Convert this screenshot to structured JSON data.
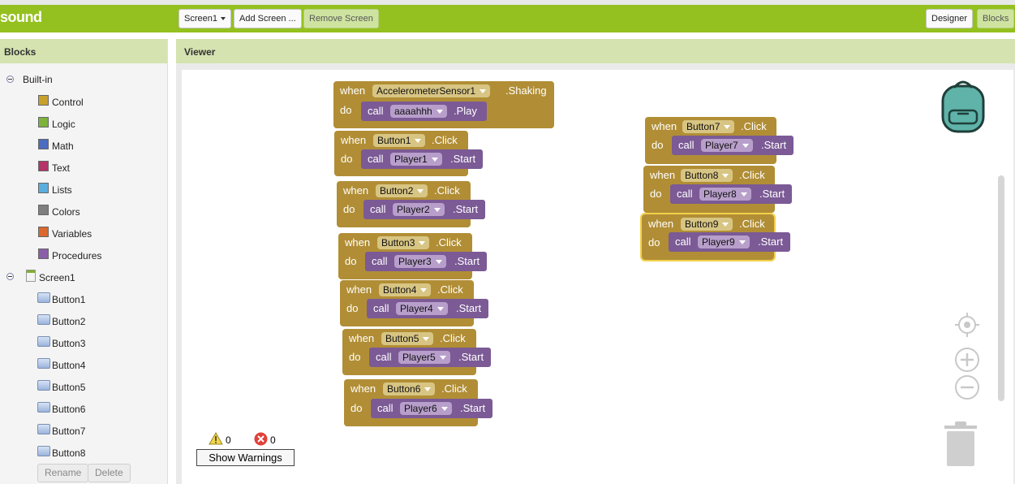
{
  "app": {
    "title": "sound"
  },
  "toolbar": {
    "screen_select": "Screen1",
    "add_screen": "Add Screen ...",
    "remove_screen": "Remove Screen",
    "designer": "Designer",
    "blocks": "Blocks"
  },
  "blocks_panel": {
    "title": "Blocks",
    "builtin_label": "Built-in",
    "builtin": [
      {
        "label": "Control",
        "color": "#c8a02c"
      },
      {
        "label": "Logic",
        "color": "#7db33a"
      },
      {
        "label": "Math",
        "color": "#4a6cc1"
      },
      {
        "label": "Text",
        "color": "#b5346a"
      },
      {
        "label": "Lists",
        "color": "#5aaede"
      },
      {
        "label": "Colors",
        "color": "#7f7f7f"
      },
      {
        "label": "Variables",
        "color": "#d9692c"
      },
      {
        "label": "Procedures",
        "color": "#8a5fa8"
      }
    ],
    "screen_label": "Screen1",
    "components": [
      "Button1",
      "Button2",
      "Button3",
      "Button4",
      "Button5",
      "Button6",
      "Button7",
      "Button8"
    ],
    "rename": "Rename",
    "delete": "Delete"
  },
  "viewer": {
    "title": "Viewer",
    "kw_when": "when",
    "kw_do": "do",
    "kw_call": "call",
    "blocks": [
      {
        "component": "AccelerometerSensor1",
        "event": ".Shaking",
        "target": "aaaahhh",
        "method": ".Play"
      },
      {
        "component": "Button1",
        "event": ".Click",
        "target": "Player1",
        "method": ".Start"
      },
      {
        "component": "Button2",
        "event": ".Click",
        "target": "Player2",
        "method": ".Start"
      },
      {
        "component": "Button3",
        "event": ".Click",
        "target": "Player3",
        "method": ".Start"
      },
      {
        "component": "Button4",
        "event": ".Click",
        "target": "Player4",
        "method": ".Start"
      },
      {
        "component": "Button5",
        "event": ".Click",
        "target": "Player5",
        "method": ".Start"
      },
      {
        "component": "Button6",
        "event": ".Click",
        "target": "Player6",
        "method": ".Start"
      },
      {
        "component": "Button7",
        "event": ".Click",
        "target": "Player7",
        "method": ".Start"
      },
      {
        "component": "Button8",
        "event": ".Click",
        "target": "Player8",
        "method": ".Start"
      },
      {
        "component": "Button9",
        "event": ".Click",
        "target": "Player9",
        "method": ".Start",
        "selected": true
      }
    ],
    "warnings_count": "0",
    "errors_count": "0",
    "show_warnings": "Show Warnings"
  },
  "colors": {
    "top_bar": "#94c11f",
    "event_block": "#b18e35",
    "call_block": "#7b5a95",
    "selection": "#f2d14b"
  },
  "icons": [
    "backpack-icon",
    "recenter-icon",
    "zoom-in-icon",
    "zoom-out-icon",
    "trash-icon",
    "warning-icon",
    "error-icon"
  ]
}
